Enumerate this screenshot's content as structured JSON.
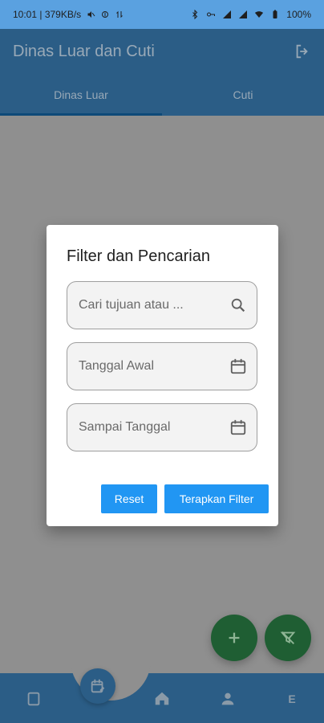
{
  "status": {
    "time_speed": "10:01 | 379KB/s",
    "battery": "100%"
  },
  "appbar": {
    "title": "Dinas Luar dan Cuti"
  },
  "tabs": [
    {
      "label": "Dinas Luar"
    },
    {
      "label": "Cuti"
    }
  ],
  "dialog": {
    "title": "Filter dan Pencarian",
    "search_placeholder": "Cari tujuan atau ...",
    "start_date_placeholder": "Tanggal Awal",
    "end_date_placeholder": "Sampai Tanggal",
    "reset_label": "Reset",
    "apply_label": "Terapkan Filter"
  },
  "bottom_nav": {
    "more_label": "E"
  },
  "icons": {
    "logout": "logout-icon",
    "search": "search-icon",
    "calendar": "calendar-icon",
    "add": "plus-icon",
    "filter_off": "filter-off-icon",
    "home": "home-icon",
    "person": "person-icon"
  },
  "colors": {
    "primary": "#2196f3",
    "appbar": "#2b5d86",
    "fab": "#1f5e33"
  }
}
